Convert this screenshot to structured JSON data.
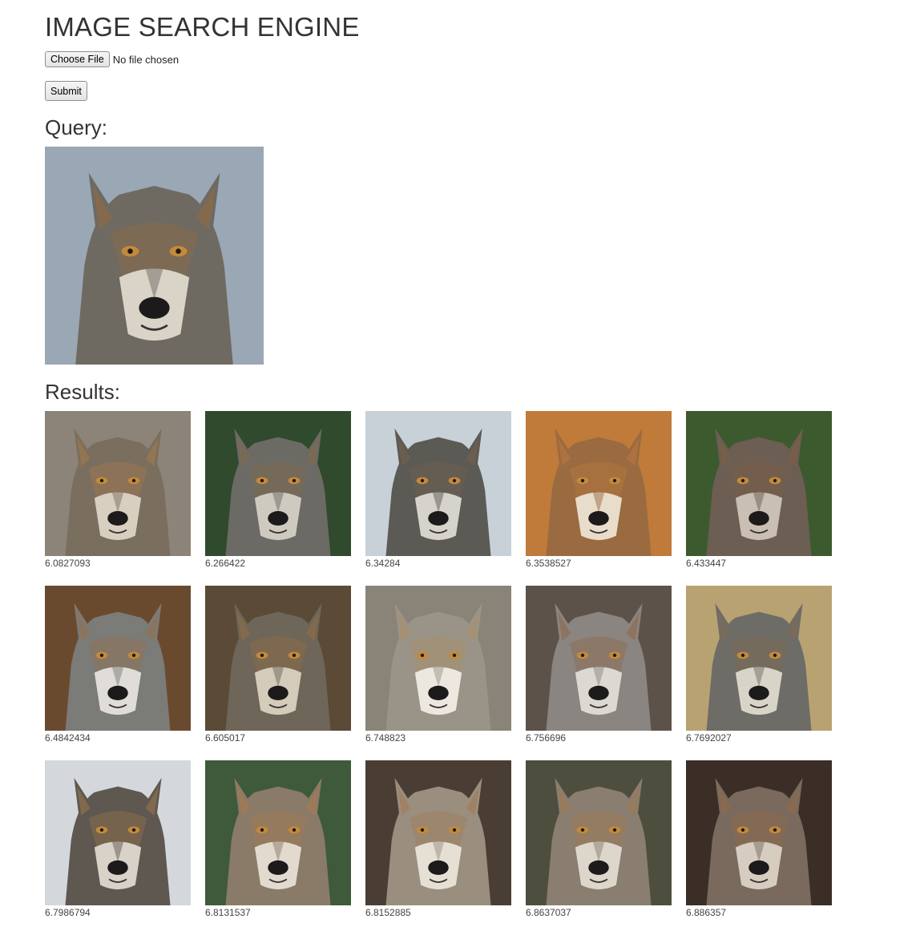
{
  "header": {
    "title": "IMAGE SEARCH ENGINE"
  },
  "upload": {
    "choose_label": "Choose File",
    "file_status": "No file chosen",
    "submit_label": "Submit"
  },
  "query": {
    "heading": "Query:",
    "image": {
      "bg": "#9aa7b4",
      "fur": "#6e6a62",
      "accent": "#8a6a48",
      "light": "#d9d3c8"
    }
  },
  "results": {
    "heading": "Results:",
    "items": [
      {
        "score": "6.0827093",
        "bg": "#8c8478",
        "fur": "#7a6e5e",
        "accent": "#9a7650",
        "light": "#d8cfc0"
      },
      {
        "score": "6.266422",
        "bg": "#2f4a2c",
        "fur": "#6c6a64",
        "accent": "#7d6a52",
        "light": "#cfcac0"
      },
      {
        "score": "6.34284",
        "bg": "#c8d0d8",
        "fur": "#5c5a55",
        "accent": "#6e604e",
        "light": "#d6d3cc"
      },
      {
        "score": "6.3538527",
        "bg": "#c07a3a",
        "fur": "#9a6a40",
        "accent": "#b0743e",
        "light": "#e8dccb"
      },
      {
        "score": "6.433447",
        "bg": "#3d5a2e",
        "fur": "#6c5e52",
        "accent": "#7a5e48",
        "light": "#c9bfb2"
      },
      {
        "score": "6.4842434",
        "bg": "#6a4a2e",
        "fur": "#7b7b78",
        "accent": "#8e7356",
        "light": "#e0ddd8"
      },
      {
        "score": "6.605017",
        "bg": "#5a4a36",
        "fur": "#6e6658",
        "accent": "#8a6c4a",
        "light": "#d4cbbb"
      },
      {
        "score": "6.748823",
        "bg": "#8a8478",
        "fur": "#9a9488",
        "accent": "#a88e6c",
        "light": "#ece8e0"
      },
      {
        "score": "6.756696",
        "bg": "#5c524a",
        "fur": "#8a8580",
        "accent": "#8e6e56",
        "light": "#dcd8d2"
      },
      {
        "score": "6.7692027",
        "bg": "#b8a272",
        "fur": "#6e6c66",
        "accent": "#7c6c56",
        "light": "#d8d4c8"
      },
      {
        "score": "6.7986794",
        "bg": "#d4d8dc",
        "fur": "#5e5850",
        "accent": "#8a6e4c",
        "light": "#d8d2c8"
      },
      {
        "score": "6.8131537",
        "bg": "#3e5a3a",
        "fur": "#8a7a68",
        "accent": "#a07a54",
        "light": "#e2dace"
      },
      {
        "score": "6.8152885",
        "bg": "#4a3e34",
        "fur": "#9a8e7e",
        "accent": "#a08060",
        "light": "#e6e0d4"
      },
      {
        "score": "6.8637037",
        "bg": "#4e4e3e",
        "fur": "#8a7e70",
        "accent": "#9a7a56",
        "light": "#ddd6ca"
      },
      {
        "score": "6.886357",
        "bg": "#3a2e26",
        "fur": "#7a6a5e",
        "accent": "#8c6a4c",
        "light": "#d6ccc0"
      }
    ]
  }
}
